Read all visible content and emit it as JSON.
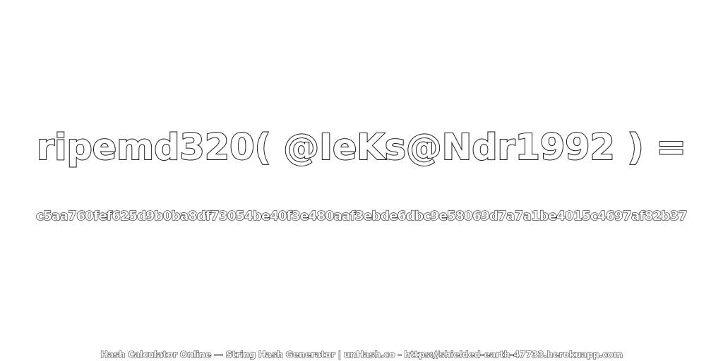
{
  "expression": "ripemd320( @IeKs@Ndr1992 ) =",
  "hash_value": "c5aa760fef625d9b0ba8df73054be40f3e480aaf3ebde6dbc9e58069d7a7a1be4015c4697af82b37",
  "footer_text": "Hash Calculator Online — String Hash Generator | unHash.co - https://shielded-earth-47733.herokuapp.com",
  "colors": {
    "background": "#ffffff",
    "text_fill": "#ffffff",
    "text_outline": "#1a1a1a"
  }
}
